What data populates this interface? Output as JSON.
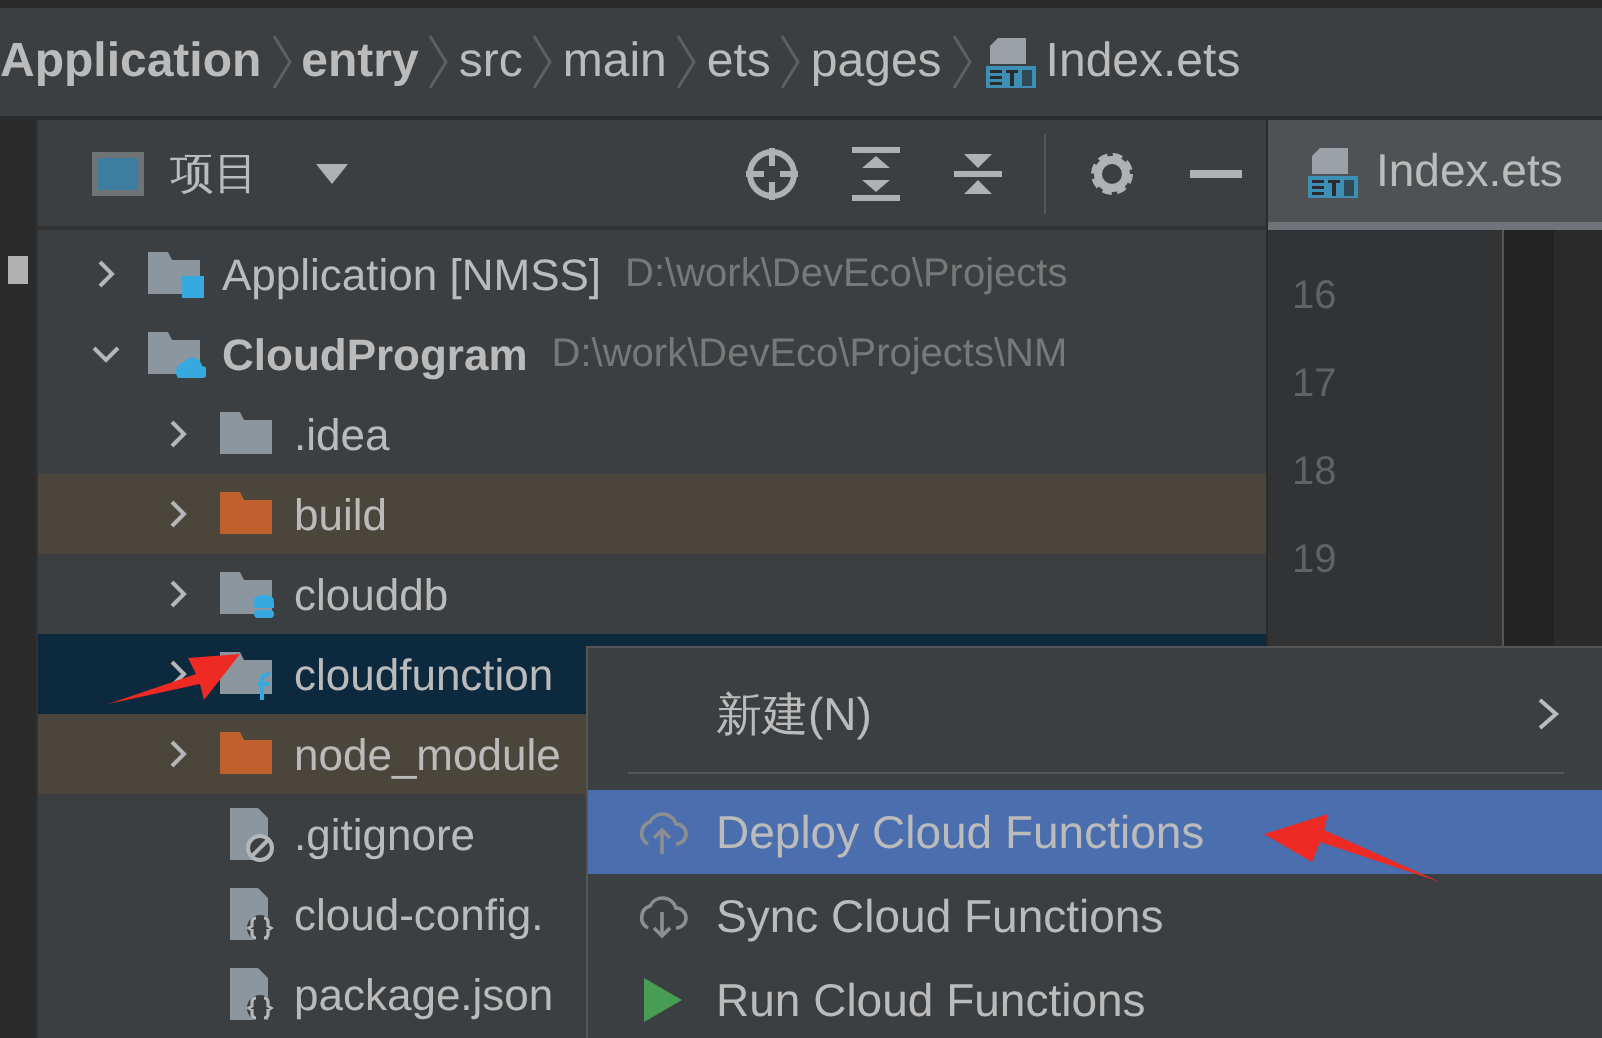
{
  "breadcrumbs": [
    {
      "label": "Application",
      "kind": "module"
    },
    {
      "label": "entry",
      "kind": "module"
    },
    {
      "label": "src",
      "kind": "folder"
    },
    {
      "label": "main",
      "kind": "folder"
    },
    {
      "label": "ets",
      "kind": "folder"
    },
    {
      "label": "pages",
      "kind": "folder"
    },
    {
      "label": "Index.ets",
      "kind": "file"
    }
  ],
  "project_panel": {
    "title": "项目"
  },
  "tree": [
    {
      "label": "Application [NMSS]",
      "path": "D:\\work\\DevEco\\Projects",
      "kind": "module",
      "expanded": false,
      "selected": false,
      "excluded": false
    },
    {
      "label": "CloudProgram",
      "path": "D:\\work\\DevEco\\Projects\\NM",
      "kind": "cloud-module",
      "expanded": true,
      "selected": false,
      "excluded": false,
      "children": [
        {
          "label": ".idea",
          "kind": "folder",
          "expanded": false,
          "selected": false,
          "excluded": false
        },
        {
          "label": "build",
          "kind": "folder",
          "expanded": false,
          "selected": false,
          "excluded": true
        },
        {
          "label": "clouddb",
          "kind": "db-folder",
          "expanded": false,
          "selected": false,
          "excluded": false
        },
        {
          "label": "cloudfunction",
          "kind": "function-folder",
          "expanded": false,
          "selected": true,
          "excluded": false
        },
        {
          "label": "node_module",
          "kind": "folder",
          "expanded": false,
          "selected": false,
          "excluded": true
        },
        {
          "label": ".gitignore",
          "kind": "ignore-file",
          "selected": false,
          "excluded": false
        },
        {
          "label": "cloud-config.",
          "kind": "config-file",
          "selected": false,
          "excluded": false
        },
        {
          "label": "package.json",
          "kind": "config-file",
          "selected": false,
          "excluded": false
        }
      ]
    }
  ],
  "editor": {
    "tab": {
      "label": "Index.ets",
      "selected": true
    },
    "line_numbers": [
      "16",
      "17",
      "18",
      "19"
    ]
  },
  "context_menu": [
    {
      "label": "新建(N)",
      "kind": "submenu",
      "selected": false
    },
    {
      "kind": "separator"
    },
    {
      "label": "Deploy Cloud Functions",
      "kind": "upload",
      "selected": true
    },
    {
      "label": "Sync Cloud Functions",
      "kind": "download",
      "selected": false
    },
    {
      "label": "Run Cloud Functions",
      "kind": "run",
      "selected": false
    }
  ]
}
